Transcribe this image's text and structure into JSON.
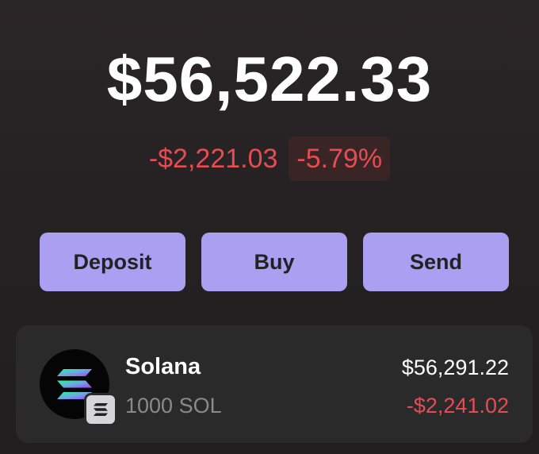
{
  "portfolio": {
    "balance": "$56,522.33",
    "change_amount": "-$2,221.03",
    "change_percent": "-5.79%"
  },
  "actions": {
    "deposit_label": "Deposit",
    "buy_label": "Buy",
    "send_label": "Send"
  },
  "tokens": [
    {
      "name": "Solana",
      "amount": "1000 SOL",
      "value": "$56,291.22",
      "change": "-$2,241.02",
      "icon": "solana-logo-icon",
      "chain_icon": "solana-chain-badge-icon"
    }
  ],
  "colors": {
    "accent": "#ab9ff2",
    "negative": "#e64c52",
    "negative_bg": "#3a2526",
    "card_bg": "#2b2a2b"
  }
}
